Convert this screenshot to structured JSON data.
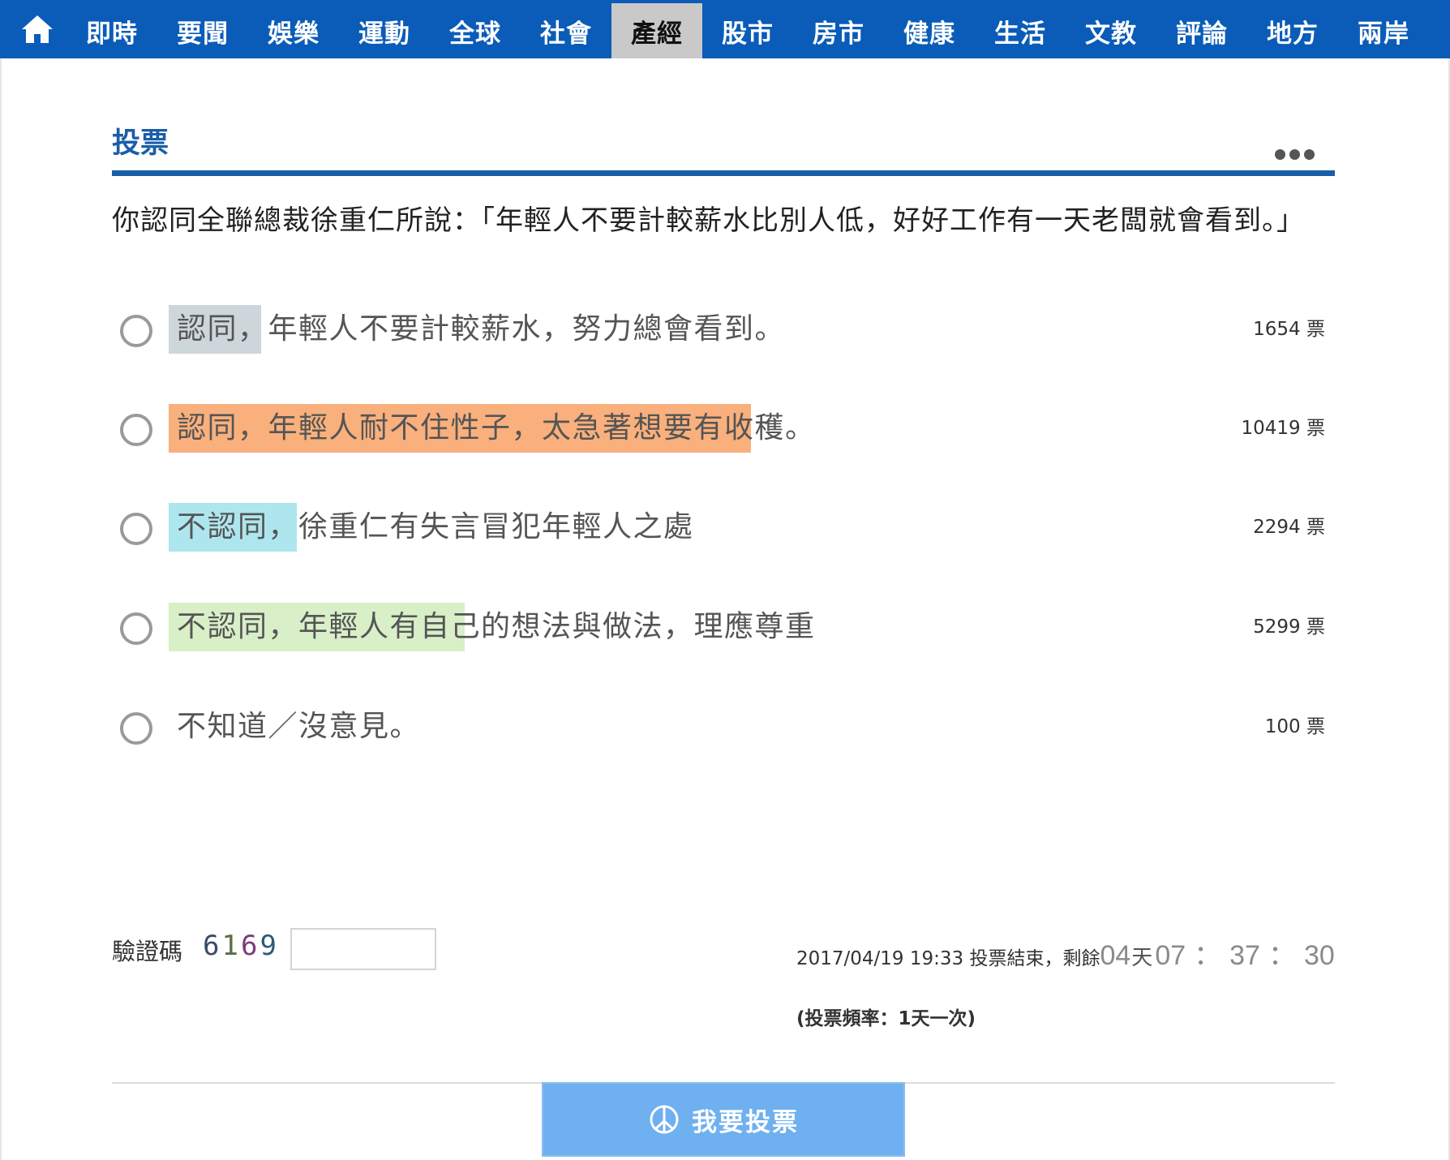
{
  "nav": {
    "home_icon": "home-icon",
    "tabs": [
      "即時",
      "要聞",
      "娛樂",
      "運動",
      "全球",
      "社會",
      "產經",
      "股市",
      "房市",
      "健康",
      "生活",
      "文教",
      "評論",
      "地方",
      "兩岸"
    ],
    "active_tab": "產經",
    "bg_color": "#0a5cb8"
  },
  "poll": {
    "section_title": "投票",
    "more_icon": "more-dots-icon",
    "question": "你認同全聯總裁徐重仁所說：「年輕人不要計較薪水比別人低，好好工作有一天老闆就會看到。」",
    "options": [
      {
        "label": "認同，年輕人不要計較薪水，努力總會看到。",
        "votes": "1654 票",
        "vote_count": 1654,
        "bar_color": "#cdd6db"
      },
      {
        "label": "認同，年輕人耐不住性子，太急著想要有收穫。",
        "votes": "10419 票",
        "vote_count": 10419,
        "bar_color": "#f9b07c"
      },
      {
        "label": "不認同，徐重仁有失言冒犯年輕人之處",
        "votes": "2294 票",
        "vote_count": 2294,
        "bar_color": "#aee6ef"
      },
      {
        "label": "不認同，年輕人有自己的想法與做法，理應尊重",
        "votes": "5299 票",
        "vote_count": 5299,
        "bar_color": "#d8efc8"
      },
      {
        "label": "不知道／沒意見。",
        "votes": "100 票",
        "vote_count": 100,
        "bar_color": "#ffffff"
      }
    ],
    "captcha_label": "驗證碼",
    "captcha_code": [
      "6",
      "1",
      "6",
      "9"
    ],
    "captcha_input_value": "",
    "deadline_text": "2017/04/19 19:33 投票結束，剩餘",
    "countdown": {
      "days": "04",
      "days_unit": "天",
      "hours": "07",
      "minutes": "37",
      "seconds": "30",
      "separator": "："
    },
    "frequency": "(投票頻率：1天一次)",
    "vote_button_label": "我要投票",
    "vote_button_icon": "peace-icon",
    "accent_color": "#1a5ea8",
    "button_color": "#6fb0f0"
  }
}
